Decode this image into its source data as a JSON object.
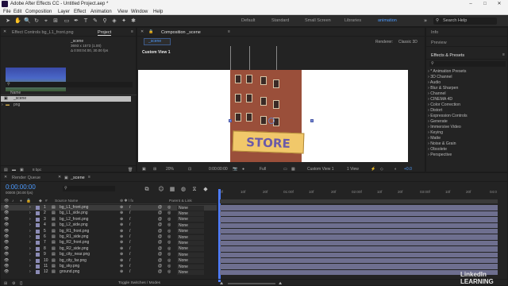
{
  "app": {
    "title": "Adobe After Effects CC - Untitled Project.aep *"
  },
  "menu": [
    "File",
    "Edit",
    "Composition",
    "Layer",
    "Effect",
    "Animation",
    "View",
    "Window",
    "Help"
  ],
  "workspaces": {
    "items": [
      "Default",
      "Standard",
      "Small Screen",
      "Libraries",
      "animation"
    ],
    "active": "animation",
    "search_placeholder": "Search Help"
  },
  "project_panel": {
    "tab_effect_controls": "Effect Controls bg_L1_front.png",
    "tab_project": "Project",
    "comp_name": "_scene",
    "comp_size": "3693 x 1573 (1.00)",
    "comp_duration": "Δ 0:00:04:00, 30.00 fps",
    "search_placeholder": "",
    "column_name": "Name",
    "items": [
      "_scene",
      "png"
    ],
    "bpc": "8 bpc"
  },
  "composition_panel": {
    "tab_label": "Composition _scene",
    "breadcrumb": "_scene",
    "renderer_label": "Renderer:",
    "renderer_value": "Classic 3D",
    "view_label": "Custom View 1",
    "zoom": "20%",
    "timecode": "0:00:00:00",
    "resolution": "Full",
    "view_select": "Custom View 1",
    "view_count": "1 View",
    "exposure": "+0.0",
    "sign_text": "STORE"
  },
  "right_panels": {
    "info": "Info",
    "preview": "Preview",
    "effects_presets": "Effects & Presets",
    "effects_list": [
      "* Animation Presets",
      "3D Channel",
      "Audio",
      "Blur & Sharpen",
      "Channel",
      "CINEMA 4D",
      "Color Correction",
      "Distort",
      "Expression Controls",
      "Generate",
      "Immersive Video",
      "Keying",
      "Matte",
      "Noise & Grain",
      "Obsolete",
      "Perspective"
    ]
  },
  "timeline": {
    "tab_render_queue": "Render Queue",
    "tab_scene": "_scene",
    "timecode": "0:00:00:00",
    "timecode_sub": "00000 (30.00 fps)",
    "col_source_name": "Source Name",
    "col_parent": "Parent & Link",
    "ruler": [
      "0f",
      "10f",
      "20f",
      "01:00f",
      "10f",
      "20f",
      "02:00f",
      "10f",
      "20f",
      "03:00f",
      "10f",
      "20f",
      "04:0"
    ],
    "layers": [
      {
        "num": "1",
        "name": "bg_L1_front.png",
        "parent": "None"
      },
      {
        "num": "2",
        "name": "bg_L1_side.png",
        "parent": "None"
      },
      {
        "num": "3",
        "name": "bg_L2_front.png",
        "parent": "None"
      },
      {
        "num": "4",
        "name": "bg_L2_side.png",
        "parent": "None"
      },
      {
        "num": "5",
        "name": "bg_R1_front.png",
        "parent": "None"
      },
      {
        "num": "6",
        "name": "bg_R1_side.png",
        "parent": "None"
      },
      {
        "num": "7",
        "name": "bg_R2_front.png",
        "parent": "None"
      },
      {
        "num": "8",
        "name": "bg_R2_side.png",
        "parent": "None"
      },
      {
        "num": "9",
        "name": "bg_city_near.png",
        "parent": "None"
      },
      {
        "num": "10",
        "name": "bg_city_far.png",
        "parent": "None"
      },
      {
        "num": "11",
        "name": "bg_sky.png",
        "parent": "None"
      },
      {
        "num": "12",
        "name": "ground.png",
        "parent": "None"
      }
    ],
    "toggle_label": "Toggle Switches / Modes"
  },
  "watermark": "LinkedIn LEARNING"
}
